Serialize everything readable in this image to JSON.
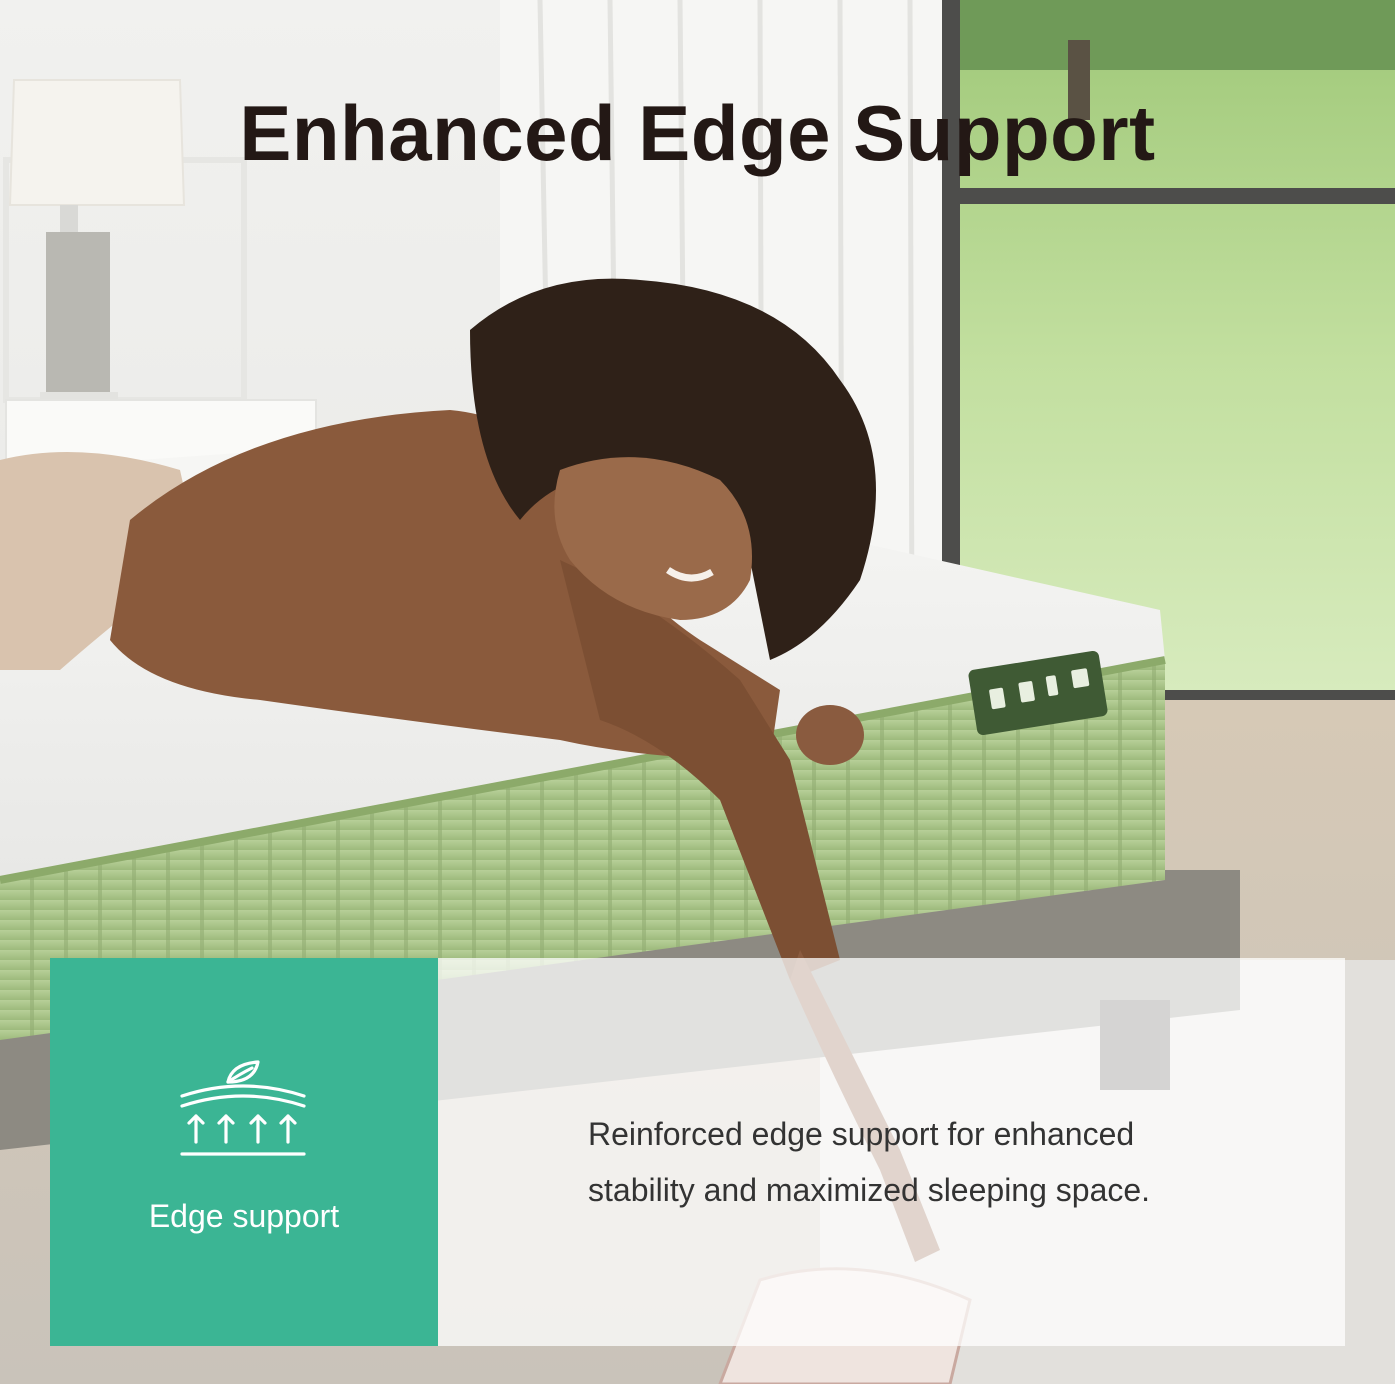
{
  "headline": "Enhanced Edge Support",
  "feature": {
    "label": "Edge support",
    "icon": "edge-support-icon",
    "panel_color": "#3bb594"
  },
  "description": {
    "line1": "Reinforced edge support for enhanced",
    "line2": "stability and maximized sleeping space."
  },
  "colors": {
    "headline": "#231815",
    "mattress_side": "#a9c48a",
    "mattress_top": "#f3f3f1",
    "sweater": "#8a5a3c",
    "lawn": "#b9d89a"
  }
}
